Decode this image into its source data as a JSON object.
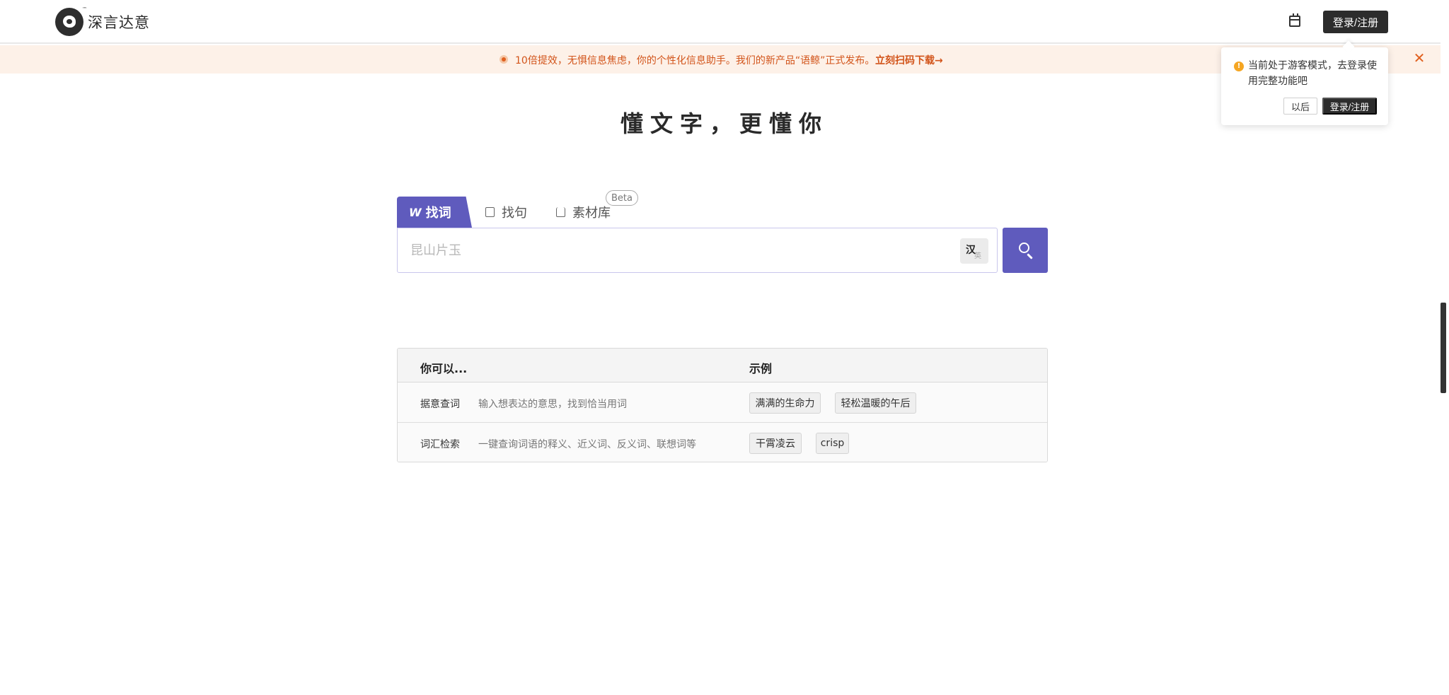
{
  "header": {
    "logo_text": "深言达意",
    "logo_tm": "™",
    "calendar_icon": "calendar-icon",
    "login_label": "登录/注册"
  },
  "banner": {
    "text": "10倍提效，无惧信息焦虑，你的个性化信息助手。我们的新产品“语鲸”正式发布。",
    "link": "立刻扫码下载→",
    "close": "✕",
    "accent_color": "#d2541a"
  },
  "popover": {
    "warn_icon": "!",
    "text": "当前处于游客模式，去登录使用完整功能吧",
    "later_label": "以后",
    "login_label": "登录/注册"
  },
  "hero": {
    "title": "懂文字，更懂你"
  },
  "tabs": [
    {
      "label": "找词",
      "icon": "word-icon",
      "glyph": "W",
      "active": true
    },
    {
      "label": "找句",
      "icon": "sentence-icon",
      "active": false
    },
    {
      "label": "素材库",
      "icon": "material-icon",
      "active": false,
      "badge": "Beta"
    }
  ],
  "search": {
    "placeholder": "昆山片玉",
    "value": "",
    "lang_zh": "汉",
    "lang_en": "英",
    "button_icon": "search-icon",
    "accent_color": "#5f5bbd"
  },
  "table": {
    "headers": [
      "你可以...",
      "示例"
    ],
    "rows": [
      {
        "name": "据意查词",
        "desc": "输入想表达的意思，找到恰当用词",
        "examples": [
          "满满的生命力",
          "轻松温暖的午后"
        ]
      },
      {
        "name": "词汇检索",
        "desc": "一键查询词语的释义、近义词、反义词、联想词等",
        "examples": [
          "干霄凌云",
          "crisp"
        ]
      }
    ]
  }
}
